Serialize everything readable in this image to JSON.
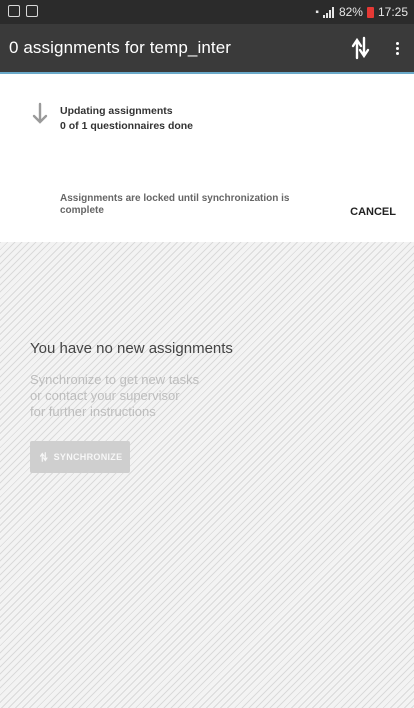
{
  "status_bar": {
    "battery": "82%",
    "time": "17:25"
  },
  "app_bar": {
    "title": "0 assignments for temp_inter",
    "sync_icon": "sync-arrows-icon",
    "menu_icon": "more-vert-icon"
  },
  "sync_panel": {
    "icon": "download-arrow-icon",
    "status_line1": "Updating assignments",
    "status_line2": "0 of 1 questionnaires done",
    "locked_message": "Assignments are locked until synchronization is complete",
    "cancel_label": "CANCEL"
  },
  "empty_state": {
    "title": "You have no new assignments",
    "hint_line1": "Synchronize to get new tasks",
    "hint_line2": "or contact your supervisor",
    "hint_line3": "for further instructions",
    "sync_button_label": "SYNCHRONIZE"
  },
  "colors": {
    "status_bar_bg": "#2b2b2b",
    "app_bar_bg": "#3a3a3a",
    "app_bar_accent": "#6aa9c9",
    "battery_low": "#e53935"
  }
}
